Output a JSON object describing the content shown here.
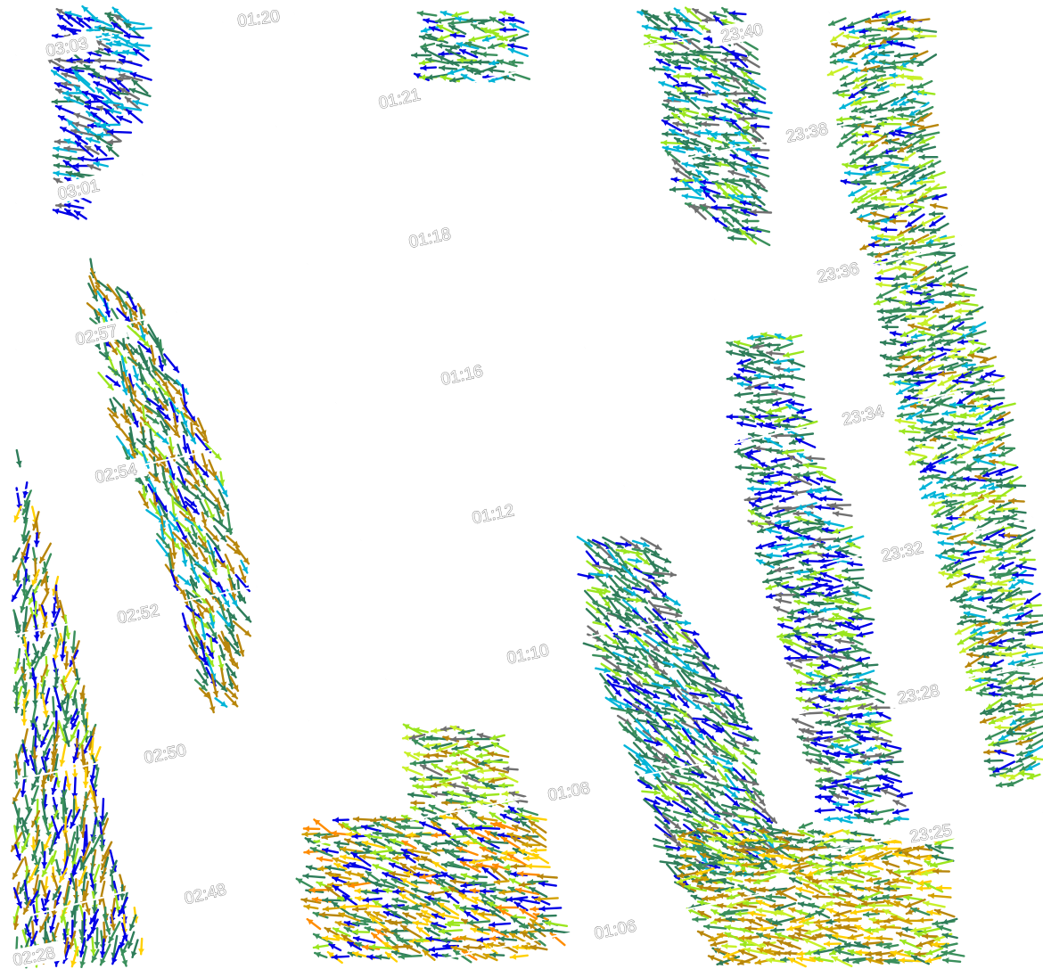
{
  "map": {
    "background": "#ffffff",
    "vector_palette": [
      "#0000e6",
      "#00b4d8",
      "#2e7d5a",
      "#3a8f5c",
      "#9be61e",
      "#c8f028",
      "#b8860b",
      "#d2a000",
      "#ffd000",
      "#ff8c00",
      "#707070"
    ],
    "time_labels": [
      "01:20",
      "03:03",
      "03:01",
      "02:57",
      "02:54",
      "02:52",
      "02:50",
      "02:48",
      "02:28",
      "01:21",
      "01:18",
      "01:16",
      "01:12",
      "01:10",
      "01:08",
      "01:06",
      "23:40",
      "23:38",
      "23:36",
      "23:34",
      "23:32",
      "23:28",
      "23:25"
    ]
  }
}
